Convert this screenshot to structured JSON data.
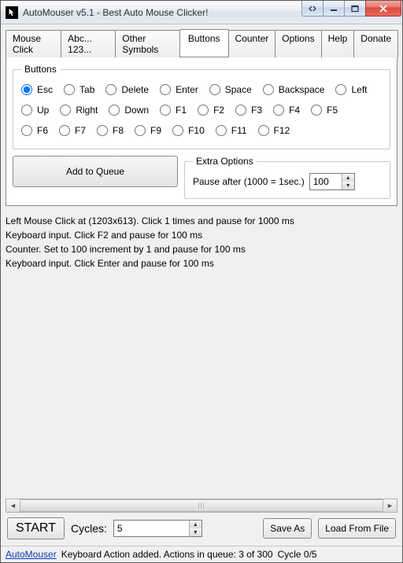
{
  "window": {
    "title": "AutoMouser v5.1 - Best Auto Mouse Clicker!"
  },
  "tabs": [
    "Mouse Click",
    "Abc... 123...",
    "Other Symbols",
    "Buttons",
    "Counter",
    "Options",
    "Help",
    "Donate"
  ],
  "buttons": {
    "legend": "Buttons",
    "add_label": "Add to Queue",
    "selected": "Esc",
    "options": [
      "Esc",
      "Tab",
      "Delete",
      "Enter",
      "Space",
      "Backspace",
      "Left",
      "Up",
      "Right",
      "Down",
      "F1",
      "F2",
      "F3",
      "F4",
      "F5",
      "F6",
      "F7",
      "F8",
      "F9",
      "F10",
      "F11",
      "F12"
    ]
  },
  "extra": {
    "legend": "Extra Options",
    "pause_label": "Pause after (1000 = 1sec.)",
    "pause_value": "100"
  },
  "queue": [
    "Left Mouse Click at  (1203x613). Click 1 times and pause for 1000 ms",
    "Keyboard input. Click F2 and pause for 100 ms",
    "Counter. Set to 100 increment by 1 and pause for 100 ms",
    "Keyboard input. Click Enter and pause for 100 ms"
  ],
  "bottom": {
    "start": "START",
    "cycles_label": "Cycles:",
    "cycles_value": "5",
    "save_as": "Save As",
    "load": "Load From File"
  },
  "status": {
    "link": "AutoMouser",
    "message": "Keyboard Action added. Actions in queue: 3 of 300",
    "cycle": "Cycle 0/5"
  }
}
